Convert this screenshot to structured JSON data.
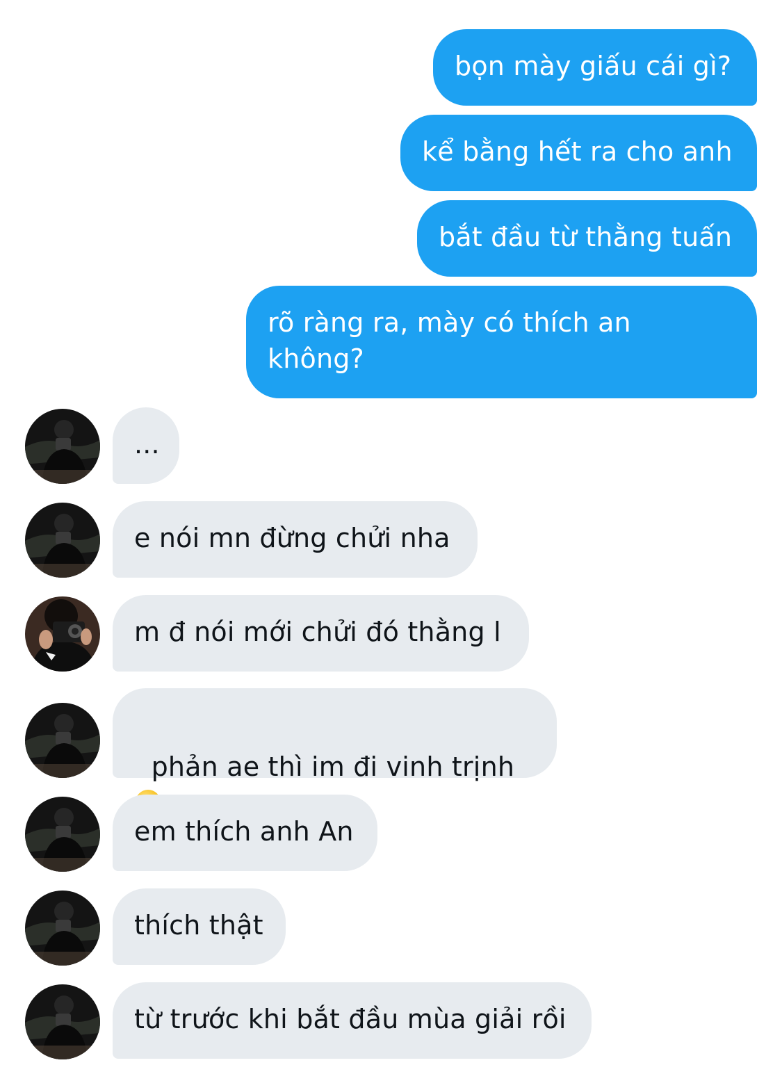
{
  "conversation": {
    "outgoing": [
      {
        "text": "bọn mày giấu cái gì?"
      },
      {
        "text": "kể bằng hết ra cho anh"
      },
      {
        "text": "bắt đầu từ thằng tuấn"
      },
      {
        "text": "rõ ràng ra, mày có thích an\nkhông?"
      }
    ],
    "incoming": [
      {
        "text": "...",
        "avatar": "avatar-dark-selfie"
      },
      {
        "text": "e nói mn đừng chửi nha",
        "avatar": "avatar-dark-selfie"
      },
      {
        "text": "m đ nói mới chửi đó thằng l",
        "avatar": "avatar-camera"
      },
      {
        "text": "phản ae thì im đi vinh trịnh",
        "avatar": "avatar-dark-selfie",
        "emoji": "slightly-smiling-face"
      },
      {
        "text": "em thích anh An",
        "avatar": "avatar-dark-selfie"
      },
      {
        "text": "thích thật",
        "avatar": "avatar-dark-selfie"
      },
      {
        "text": "từ trước khi bắt đầu mùa giải rồi",
        "avatar": "avatar-dark-selfie"
      }
    ]
  },
  "colors": {
    "outgoing_bubble": "#1da1f2",
    "incoming_bubble": "#e7ebef",
    "incoming_text": "#0f1419",
    "outgoing_text": "#ffffff"
  }
}
